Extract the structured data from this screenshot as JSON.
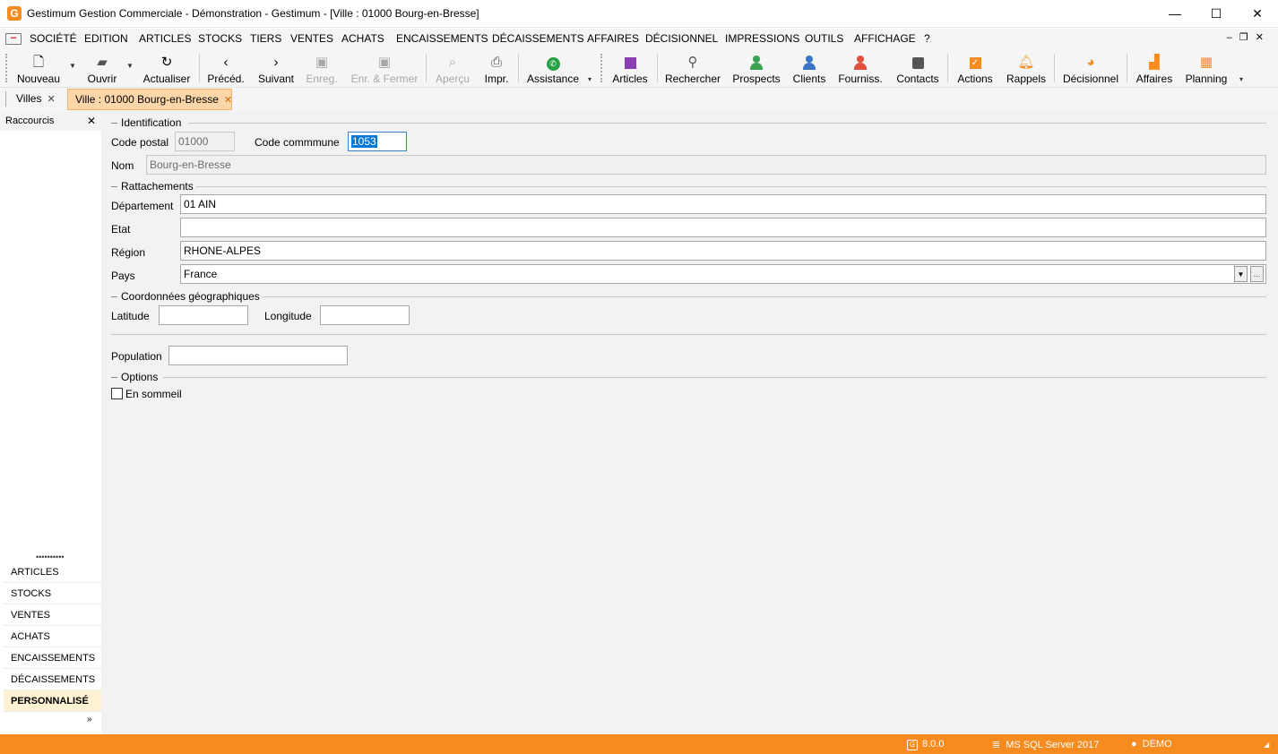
{
  "window": {
    "title": "Gestimum Gestion Commerciale - Démonstration - Gestimum - [Ville : 01000 Bourg-en-Bresse]",
    "app_icon": "G",
    "controls": {
      "minimize": "—",
      "maximize": "☐",
      "close": "✕"
    }
  },
  "menu": {
    "items": [
      "SOCIÉTÉ",
      "EDITION",
      "ARTICLES",
      "STOCKS",
      "TIERS",
      "VENTES",
      "ACHATS",
      "ENCAISSEMENTS",
      "DÉCAISSEMENTS",
      "AFFAIRES",
      "DÉCISIONNEL",
      "IMPRESSIONS",
      "OUTILS",
      "AFFICHAGE",
      "?"
    ]
  },
  "toolbar": {
    "nouveau": "Nouveau",
    "ouvrir": "Ouvrir",
    "actualiser": "Actualiser",
    "preced": "Précéd.",
    "suivant": "Suivant",
    "enreg": "Enreg.",
    "enr_fermer": "Enr. & Fermer",
    "apercu": "Aperçu",
    "impr": "Impr.",
    "assistance": "Assistance",
    "articles": "Articles",
    "rechercher": "Rechercher",
    "prospects": "Prospects",
    "clients": "Clients",
    "fourniss": "Fourniss.",
    "contacts": "Contacts",
    "actions": "Actions",
    "rappels": "Rappels",
    "decisionnel": "Décisionnel",
    "affaires": "Affaires",
    "planning": "Planning"
  },
  "tabs": [
    {
      "label": "Villes",
      "close": "✕"
    },
    {
      "label": "Ville : 01000 Bourg-en-Bresse",
      "close": "✕",
      "active": true
    }
  ],
  "sidebar": {
    "title": "Raccourcis",
    "close": "✕",
    "grip": "••••••••••",
    "items": [
      "ARTICLES",
      "STOCKS",
      "VENTES",
      "ACHATS",
      "ENCAISSEMENTS",
      "DÉCAISSEMENTS",
      "PERSONNALISÉ"
    ],
    "active_item": "PERSONNALISÉ",
    "more": "»"
  },
  "form": {
    "identification": {
      "title": "Identification",
      "code_postal_label": "Code postal",
      "code_postal_value": "01000",
      "code_commune_label": "Code commmune",
      "code_commune_value": "1053",
      "nom_label": "Nom",
      "nom_value": "Bourg-en-Bresse"
    },
    "rattachements": {
      "title": "Rattachements",
      "departement_label": "Département",
      "departement_value": "01 AIN",
      "etat_label": "Etat",
      "etat_value": "",
      "region_label": "Région",
      "region_value": "RHONE-ALPES",
      "pays_label": "Pays",
      "pays_value": "France"
    },
    "coordonnees": {
      "title": "Coordonnées géographiques",
      "latitude_label": "Latitude",
      "latitude_value": "",
      "longitude_label": "Longitude",
      "longitude_value": ""
    },
    "population_label": "Population",
    "population_value": "",
    "options": {
      "title": "Options",
      "en_sommeil_label": "En sommeil",
      "en_sommeil_checked": false
    }
  },
  "status": {
    "version": "8.0.0",
    "database": "MS SQL Server 2017",
    "user": "DEMO"
  },
  "colors": {
    "accent": "#f68b1f",
    "active_tab": "#fbd6a8",
    "selection": "#0078d7"
  }
}
